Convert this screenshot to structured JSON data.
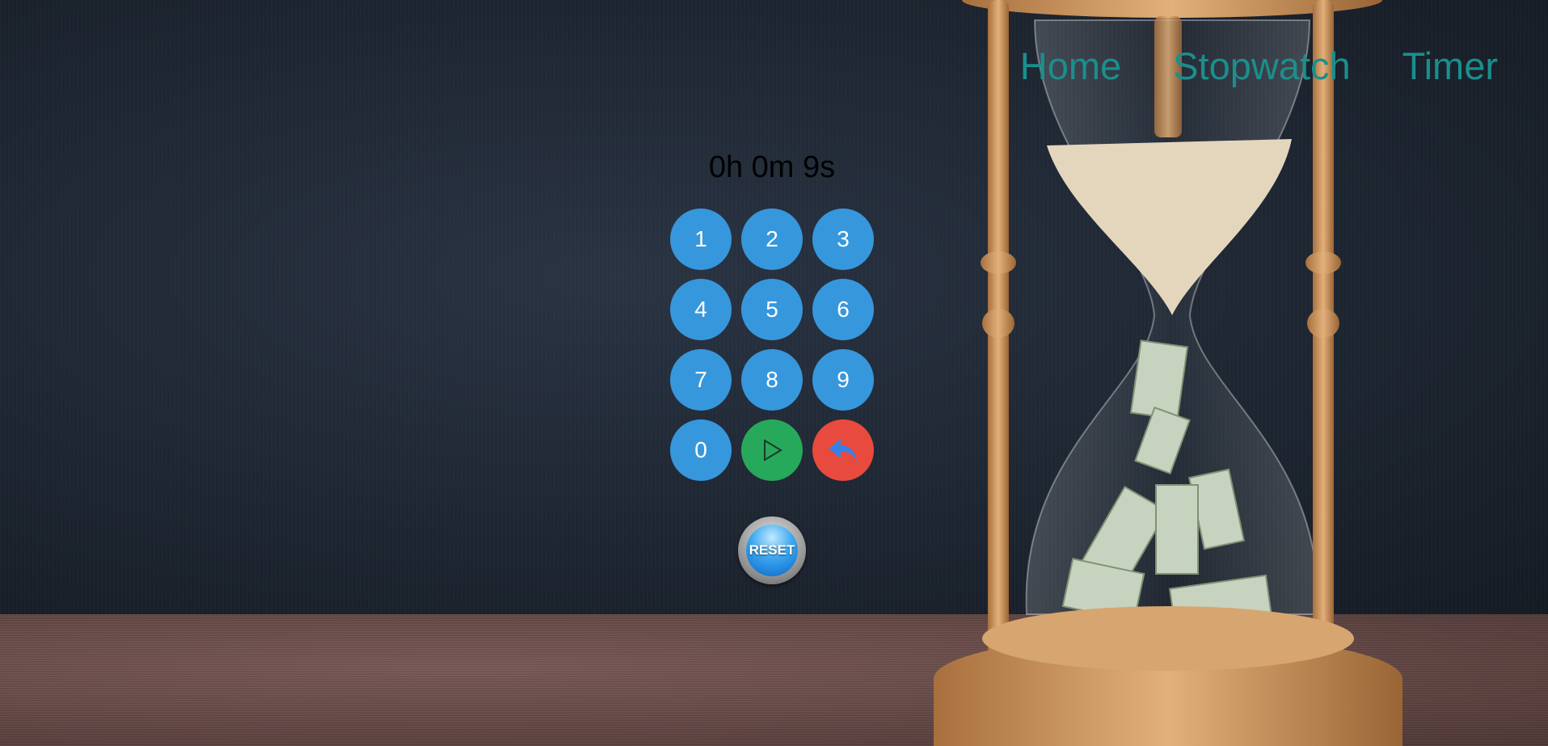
{
  "nav": {
    "home": "Home",
    "stopwatch": "Stopwatch",
    "timer": "Timer"
  },
  "timer": {
    "display": "0h 0m 9s"
  },
  "keypad": {
    "keys": [
      "1",
      "2",
      "3",
      "4",
      "5",
      "6",
      "7",
      "8",
      "9",
      "0"
    ],
    "play_icon": "play-icon",
    "back_icon": "undo-arrow-icon"
  },
  "reset": {
    "label": "RESET"
  },
  "colors": {
    "accent_nav": "#1a8f8c",
    "key_blue": "#3797dc",
    "play_green": "#27a95b",
    "back_red": "#e84b3d"
  }
}
